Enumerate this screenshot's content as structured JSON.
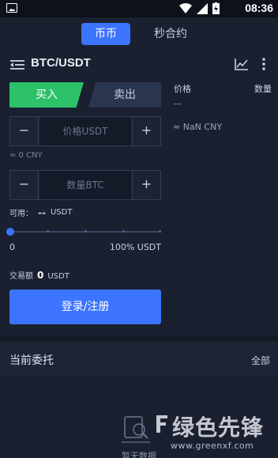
{
  "status_bar": {
    "time": "08:36"
  },
  "tabs": [
    {
      "label": "币币",
      "active": true
    },
    {
      "label": "秒合约",
      "active": false
    }
  ],
  "pair": {
    "title": "BTC/USDT"
  },
  "trade": {
    "buy_label": "买入",
    "sell_label": "卖出",
    "price_placeholder": "价格USDT",
    "price_cny": "≈ 0 CNY",
    "qty_placeholder": "数量BTC",
    "minus": "−",
    "plus": "+",
    "available_label": "可用：",
    "available_value": "--",
    "available_unit": "USDT",
    "slider_min": "0",
    "slider_max": "100% USDT",
    "slider_percent": 0,
    "amount_label": "交易额",
    "amount_value": "0",
    "amount_unit": "USDT",
    "login_label": "登录/注册"
  },
  "orderbook": {
    "price_header": "价格",
    "qty_header": "数量",
    "last_price": "--",
    "last_cny": "≈ NaN CNY"
  },
  "orders": {
    "title": "当前委托",
    "all_label": "全部",
    "empty_text": "暂无数据"
  },
  "watermark": {
    "main": "绿色先锋",
    "url": "www.greenxf.com"
  },
  "colors": {
    "accent": "#3d74ff",
    "buy": "#2dc16a",
    "background": "#1a2030"
  }
}
